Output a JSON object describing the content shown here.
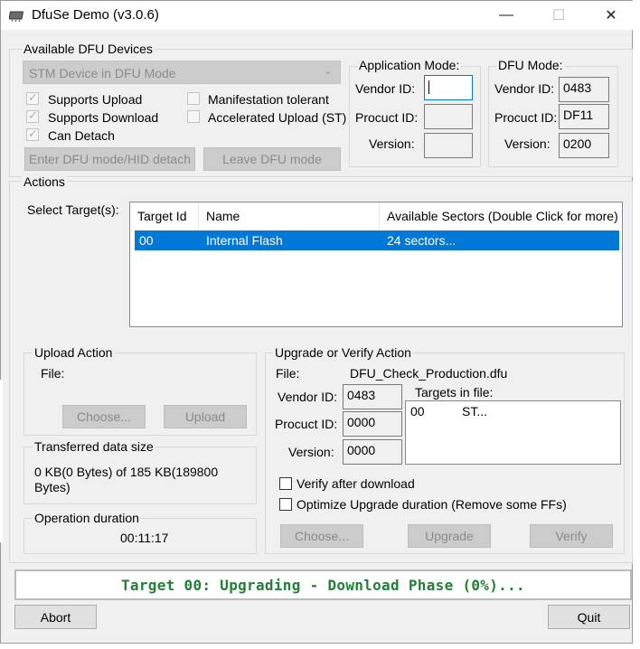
{
  "window": {
    "title": "DfuSe Demo (v3.0.6)",
    "controls": {
      "minimize": "—",
      "maximize": "☐",
      "close": "✕"
    }
  },
  "devices": {
    "group_label": "Available DFU Devices",
    "selected_device": "STM Device in DFU Mode",
    "supports_upload": "Supports Upload",
    "supports_download": "Supports Download",
    "can_detach": "Can Detach",
    "manifestation_tolerant": "Manifestation tolerant",
    "accelerated_upload": "Accelerated Upload (ST)",
    "enter_dfu_button": "Enter DFU mode/HID detach",
    "leave_dfu_button": "Leave DFU mode"
  },
  "app_mode": {
    "label": "Application Mode:",
    "vendor_label": "Vendor ID:",
    "product_label": "Procuct ID:",
    "version_label": "Version:",
    "vendor_value": "",
    "product_value": "",
    "version_value": ""
  },
  "dfu_mode": {
    "label": "DFU Mode:",
    "vendor_label": "Vendor ID:",
    "product_label": "Procuct ID:",
    "version_label": "Version:",
    "vendor_value": "0483",
    "product_value": "DF11",
    "version_value": "0200"
  },
  "actions": {
    "group_label": "Actions",
    "select_targets_label": "Select Target(s):",
    "columns": [
      "Target Id",
      "Name",
      "Available Sectors (Double Click for more)"
    ],
    "rows": [
      {
        "target_id": "00",
        "name": "Internal Flash",
        "sectors": "24 sectors..."
      }
    ]
  },
  "upload": {
    "group_label": "Upload Action",
    "file_label": "File:",
    "choose_button": "Choose...",
    "upload_button": "Upload"
  },
  "transferred": {
    "group_label": "Transferred data size",
    "value_line1": "0 KB(0 Bytes) of 185 KB(189800",
    "value_line2": "Bytes)"
  },
  "duration": {
    "group_label": "Operation duration",
    "value": "00:11:17"
  },
  "upgrade": {
    "group_label": "Upgrade or Verify Action",
    "file_label": "File:",
    "file_name": "DFU_Check_Production.dfu",
    "vendor_label": "Vendor ID:",
    "product_label": "Procuct ID:",
    "version_label": "Version:",
    "vendor_value": "0483",
    "product_value": "0000",
    "version_value": "0000",
    "targets_label": "Targets in file:",
    "targets": [
      {
        "id": "00",
        "name": "ST..."
      }
    ],
    "verify_after_download": "Verify after download",
    "optimize_upgrade": "Optimize Upgrade duration (Remove some FFs)",
    "choose_button": "Choose...",
    "upgrade_button": "Upgrade",
    "verify_button": "Verify"
  },
  "status": {
    "text": "Target 00: Upgrading - Download Phase (0%)...",
    "color": "#218035",
    "progress_percent": 0
  },
  "footer": {
    "abort_button": "Abort",
    "quit_button": "Quit"
  }
}
